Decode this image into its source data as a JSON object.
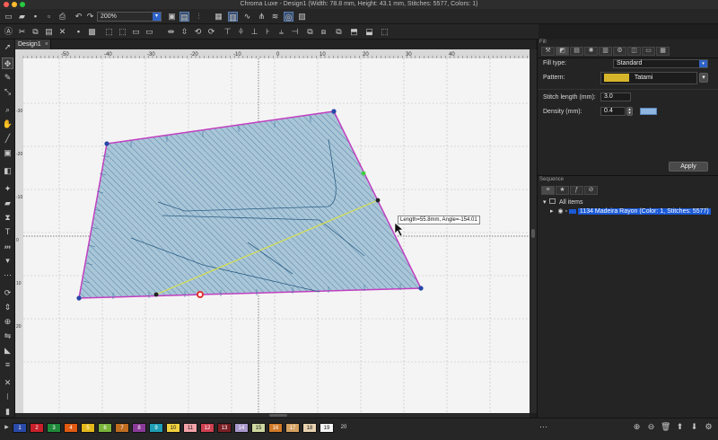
{
  "window": {
    "title": "Chroma Luxe - Design1 (Width: 78.8 mm, Height: 43.1 mm, Stitches: 5577, Colors: 1)"
  },
  "toolbar": {
    "zoom_value": "200%"
  },
  "document_tab": {
    "label": "Design1",
    "close": "×"
  },
  "rulers": {
    "horizontal_ticks": [
      "-50",
      "-40",
      "-30",
      "-20",
      "-10",
      "0",
      "10",
      "20",
      "30",
      "40"
    ],
    "vertical_ticks": [
      "-30",
      "-20",
      "-10",
      "0",
      "10",
      "20"
    ]
  },
  "canvas": {
    "measure_tooltip": "Length=55.8mm, Angle=-154.01",
    "shape_fill_color": "#9fc1d6",
    "shape_outline_color": "#c040c0",
    "measure_line_color": "#d8e04a",
    "stitch_color": "#3a6f9a"
  },
  "fill_panel": {
    "header": "Fill",
    "fill_type_label": "Fill type:",
    "fill_type_value": "Standard",
    "pattern_label": "Pattern:",
    "pattern_value": "Tatami",
    "pattern_swatch_color": "#d7b52b",
    "stitch_length_label": "Stitch length (mm):",
    "stitch_length_value": "3.0",
    "density_label": "Density (mm):",
    "density_value": "0.4",
    "apply_label": "Apply"
  },
  "sequence_panel": {
    "header": "Sequence",
    "root_label": "All items",
    "item_label": "1134 Madeira Rayon (Color: 1, Stitches: 5577)"
  },
  "palette": {
    "swatches": [
      {
        "label": "1",
        "color": "#2a4aa8"
      },
      {
        "label": "2",
        "color": "#c8202a"
      },
      {
        "label": "3",
        "color": "#1f8a3a"
      },
      {
        "label": "4",
        "color": "#e05a12"
      },
      {
        "label": "5",
        "color": "#e4b81a"
      },
      {
        "label": "6",
        "color": "#7ab43a"
      },
      {
        "label": "7",
        "color": "#c06d20"
      },
      {
        "label": "8",
        "color": "#8a3a98"
      },
      {
        "label": "9",
        "color": "#1e9db4"
      },
      {
        "label": "10",
        "color": "#f0d040"
      },
      {
        "label": "11",
        "color": "#f2a2a8"
      },
      {
        "label": "12",
        "color": "#ce4050"
      },
      {
        "label": "13",
        "color": "#7a1f24"
      },
      {
        "label": "14",
        "color": "#a898cc"
      },
      {
        "label": "15",
        "color": "#cfd8a0"
      },
      {
        "label": "16",
        "color": "#d07a28"
      },
      {
        "label": "17",
        "color": "#d4a060"
      },
      {
        "label": "18",
        "color": "#e8d2b0"
      },
      {
        "label": "19",
        "color": "#f4f4f4"
      },
      {
        "label": "20",
        "color": "#262626"
      }
    ]
  }
}
